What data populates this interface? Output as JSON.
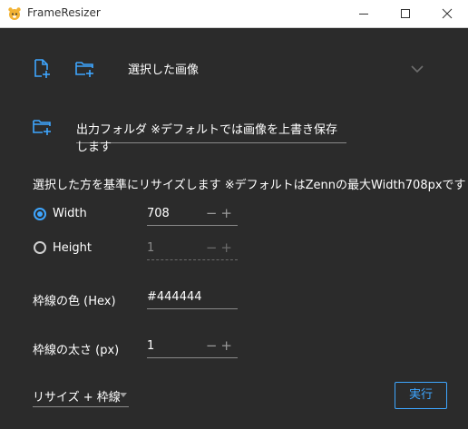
{
  "window": {
    "title": "FrameResizer",
    "accent_color": "#3ea6ff"
  },
  "toolbar": {
    "selected_images_label": "選択した画像"
  },
  "output": {
    "placeholder": "出力フォルダ ※デフォルトでは画像を上書き保存します"
  },
  "resize": {
    "description": "選択した方を基準にリサイズします ※デフォルトはZennの最大Width708pxです",
    "width_label": "Width",
    "width_value": "708",
    "height_label": "Height",
    "height_value": "1",
    "selected": "Width"
  },
  "border_color": {
    "label": "枠線の色 (Hex)",
    "value": "#444444"
  },
  "border_thickness": {
    "label": "枠線の太さ (px)",
    "value": "1"
  },
  "mode": {
    "selected": "リサイズ + 枠線"
  },
  "actions": {
    "run_label": "実行"
  }
}
